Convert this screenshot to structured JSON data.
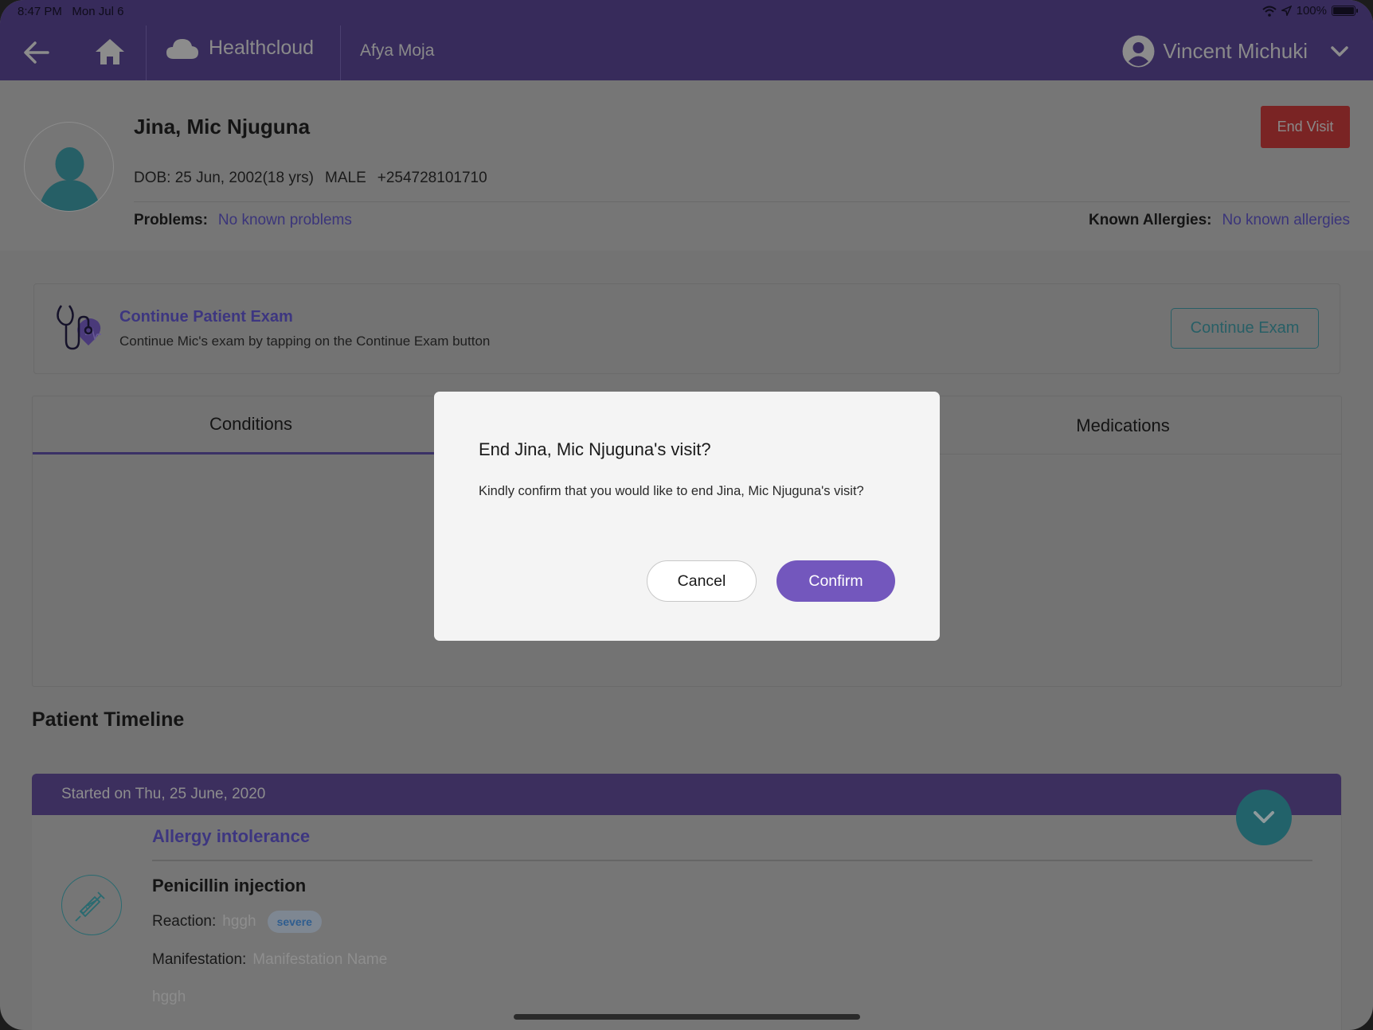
{
  "status_bar": {
    "time": "8:47 PM",
    "date": "Mon Jul 6",
    "battery": "100%",
    "icons": [
      "wifi-icon",
      "location-arrow-icon",
      "battery-icon"
    ]
  },
  "nav": {
    "back_icon": "arrow-left-icon",
    "home_icon": "home-icon",
    "brand_icon": "cloud-icon",
    "brand_name": "Healthcloud",
    "org_name": "Afya Moja",
    "user_name": "Vincent Michuki",
    "user_icon": "user-circle-icon",
    "menu_icon": "chevron-down-icon"
  },
  "patient": {
    "name": "Jina, Mic Njuguna",
    "dob": "DOB: 25 Jun, 2002(18 yrs)",
    "gender": "MALE",
    "phone": "+254728101710",
    "problems_label": "Problems:",
    "problems_value": "No known problems",
    "allergies_label": "Known Allergies:",
    "allergies_value": "No known allergies",
    "end_visit_label": "End Visit"
  },
  "exam": {
    "title": "Continue Patient Exam",
    "subtitle": "Continue Mic's exam by tapping on the Continue Exam button",
    "button_label": "Continue Exam"
  },
  "tabs": [
    {
      "label": "Conditions",
      "active": true
    },
    {
      "label": "Medications",
      "active": false
    }
  ],
  "timeline": {
    "title": "Patient Timeline",
    "entries": [
      {
        "started": "Started on Thu, 25 June, 2020",
        "category": "Allergy intolerance",
        "item": "Penicillin injection",
        "reaction_label": "Reaction:",
        "reaction_value": "hggh",
        "severity": "severe",
        "manifestation_label": "Manifestation:",
        "manifestation_value": "Manifestation Name",
        "note": "hggh"
      }
    ]
  },
  "modal": {
    "title": "End Jina, Mic Njuguna's visit?",
    "body": "Kindly confirm that you would like to end Jina, Mic Njuguna's visit?",
    "cancel_label": "Cancel",
    "confirm_label": "Confirm"
  },
  "colors": {
    "brand_purple": "#6A4FC2",
    "confirm_button": "#7357BD",
    "end_visit_red": "#D23A3A",
    "teal_accent": "#2A8A95",
    "overlay_dim": "rgba(0,0,0,0.55)"
  }
}
